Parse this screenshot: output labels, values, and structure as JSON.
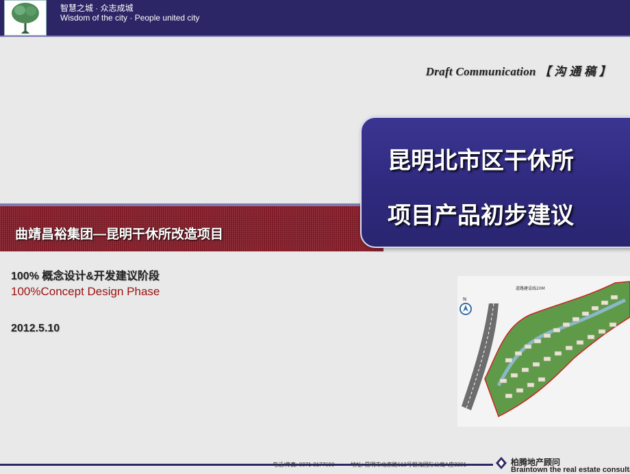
{
  "header": {
    "logo_icon": "city-tree-logo",
    "logo_text": "智慧之城",
    "tagline_cn": "智慧之城 · 众志成城",
    "tagline_en": "Wisdom of the city · People united city"
  },
  "draft_label": "Draft Communication 【 沟 通 稿 】",
  "title": {
    "line1": "昆明北市区干休所",
    "line2": "项目产品初步建议"
  },
  "band_title": "曲靖昌裕集团—昆明干休所改造项目",
  "phase_cn": "100% 概念设计&开发建议阶段",
  "phase_en": "100%Concept Design Phase",
  "date": "2012.5.10",
  "site_plan": {
    "road_label": "道路建设线20M",
    "north_label": "N",
    "icon": "site-plan-image"
  },
  "footer": {
    "contact": "电话/传真: 0871-3177600",
    "address": "地址: 昆明市北京路612号银海国际公寓A座3201",
    "brand_cn": "柏腾地产顾问",
    "brand_en": "Braintown the real estate consultant"
  },
  "colors": {
    "header_bg": "#2c2566",
    "title_box": "#3b3592",
    "band": "#8a1d2a",
    "accent_red": "#9b1010"
  }
}
